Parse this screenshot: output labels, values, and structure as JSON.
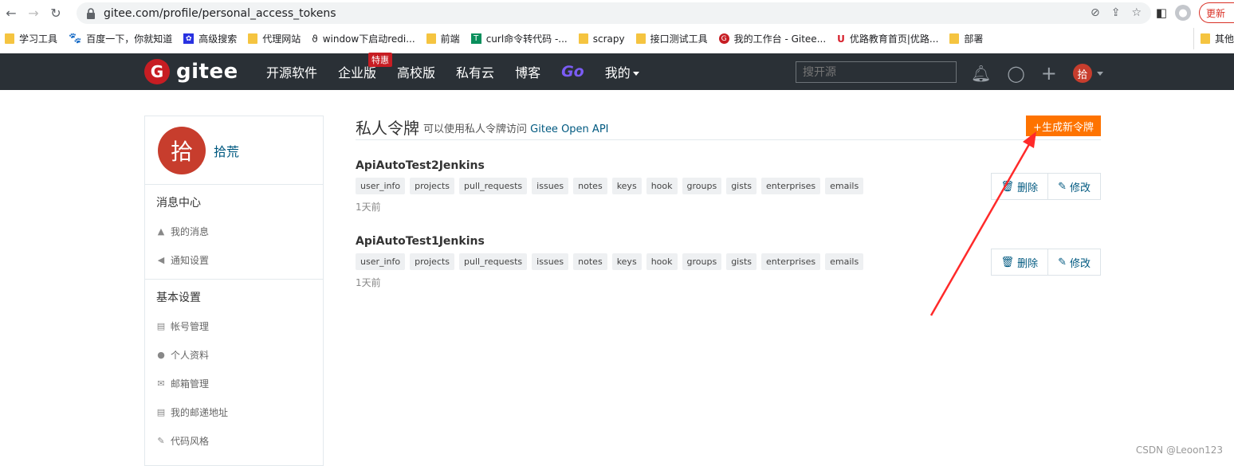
{
  "browser": {
    "url": "gitee.com/profile/personal_access_tokens",
    "update_label": "更新",
    "bookmarks": [
      "学习工具",
      "百度一下，你就知道",
      "高级搜索",
      "代理网站",
      "window下启动redi...",
      "前端",
      "curl命令转代码 -...",
      "scrapy",
      "接口测试工具",
      "我的工作台 - Gitee...",
      "优路教育首页|优路...",
      "部署"
    ],
    "bookmarks_other": "其他"
  },
  "header": {
    "logo_text": "gitee",
    "nav": [
      "开源软件",
      "企业版",
      "高校版",
      "私有云",
      "博客",
      "Go",
      "我的"
    ],
    "hot_badge": "特惠",
    "search_placeholder": "搜开源",
    "avatar_char": "拾"
  },
  "sidebar": {
    "avatar_char": "拾",
    "username": "拾荒",
    "sections": [
      {
        "title": "消息中心",
        "items": [
          {
            "label": "我的消息",
            "icon": "bell-icon"
          },
          {
            "label": "通知设置",
            "icon": "speaker-icon"
          }
        ]
      },
      {
        "title": "基本设置",
        "items": [
          {
            "label": "帐号管理",
            "icon": "id-card-icon"
          },
          {
            "label": "个人资料",
            "icon": "user-icon"
          },
          {
            "label": "邮箱管理",
            "icon": "mail-icon"
          },
          {
            "label": "我的邮递地址",
            "icon": "address-card-icon"
          },
          {
            "label": "代码风格",
            "icon": "brush-icon"
          }
        ]
      }
    ]
  },
  "main": {
    "title": "私人令牌",
    "subtitle": "可以使用私人令牌访问",
    "subtitle_link": "Gitee Open API",
    "generate_label": "+生成新令牌",
    "delete_label": "删除",
    "edit_label": "修改",
    "tokens": [
      {
        "name": "ApiAutoTest2Jenkins",
        "scopes": [
          "user_info",
          "projects",
          "pull_requests",
          "issues",
          "notes",
          "keys",
          "hook",
          "groups",
          "gists",
          "enterprises",
          "emails"
        ],
        "time": "1天前"
      },
      {
        "name": "ApiAutoTest1Jenkins",
        "scopes": [
          "user_info",
          "projects",
          "pull_requests",
          "issues",
          "notes",
          "keys",
          "hook",
          "groups",
          "gists",
          "enterprises",
          "emails"
        ],
        "time": "1天前"
      }
    ]
  },
  "watermark": "CSDN @Leoon123",
  "colors": {
    "header_bg": "#2a3036",
    "accent": "#fe7300",
    "brand_red": "#c71d23",
    "annotation_red": "#ff2a2a"
  }
}
